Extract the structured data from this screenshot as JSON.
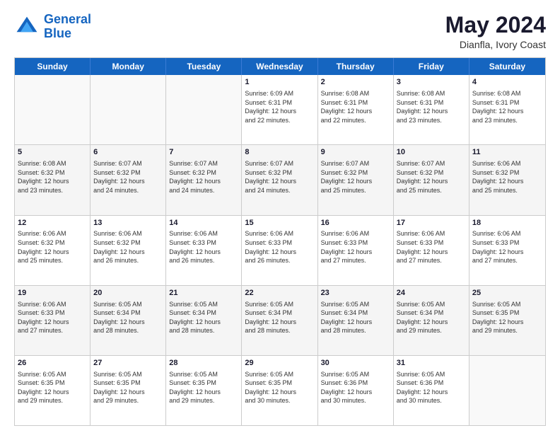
{
  "header": {
    "logo_line1": "General",
    "logo_line2": "Blue",
    "month": "May 2024",
    "location": "Dianfla, Ivory Coast"
  },
  "weekdays": [
    "Sunday",
    "Monday",
    "Tuesday",
    "Wednesday",
    "Thursday",
    "Friday",
    "Saturday"
  ],
  "rows": [
    [
      {
        "day": "",
        "info": ""
      },
      {
        "day": "",
        "info": ""
      },
      {
        "day": "",
        "info": ""
      },
      {
        "day": "1",
        "info": "Sunrise: 6:09 AM\nSunset: 6:31 PM\nDaylight: 12 hours\nand 22 minutes."
      },
      {
        "day": "2",
        "info": "Sunrise: 6:08 AM\nSunset: 6:31 PM\nDaylight: 12 hours\nand 22 minutes."
      },
      {
        "day": "3",
        "info": "Sunrise: 6:08 AM\nSunset: 6:31 PM\nDaylight: 12 hours\nand 23 minutes."
      },
      {
        "day": "4",
        "info": "Sunrise: 6:08 AM\nSunset: 6:31 PM\nDaylight: 12 hours\nand 23 minutes."
      }
    ],
    [
      {
        "day": "5",
        "info": "Sunrise: 6:08 AM\nSunset: 6:32 PM\nDaylight: 12 hours\nand 23 minutes."
      },
      {
        "day": "6",
        "info": "Sunrise: 6:07 AM\nSunset: 6:32 PM\nDaylight: 12 hours\nand 24 minutes."
      },
      {
        "day": "7",
        "info": "Sunrise: 6:07 AM\nSunset: 6:32 PM\nDaylight: 12 hours\nand 24 minutes."
      },
      {
        "day": "8",
        "info": "Sunrise: 6:07 AM\nSunset: 6:32 PM\nDaylight: 12 hours\nand 24 minutes."
      },
      {
        "day": "9",
        "info": "Sunrise: 6:07 AM\nSunset: 6:32 PM\nDaylight: 12 hours\nand 25 minutes."
      },
      {
        "day": "10",
        "info": "Sunrise: 6:07 AM\nSunset: 6:32 PM\nDaylight: 12 hours\nand 25 minutes."
      },
      {
        "day": "11",
        "info": "Sunrise: 6:06 AM\nSunset: 6:32 PM\nDaylight: 12 hours\nand 25 minutes."
      }
    ],
    [
      {
        "day": "12",
        "info": "Sunrise: 6:06 AM\nSunset: 6:32 PM\nDaylight: 12 hours\nand 25 minutes."
      },
      {
        "day": "13",
        "info": "Sunrise: 6:06 AM\nSunset: 6:32 PM\nDaylight: 12 hours\nand 26 minutes."
      },
      {
        "day": "14",
        "info": "Sunrise: 6:06 AM\nSunset: 6:33 PM\nDaylight: 12 hours\nand 26 minutes."
      },
      {
        "day": "15",
        "info": "Sunrise: 6:06 AM\nSunset: 6:33 PM\nDaylight: 12 hours\nand 26 minutes."
      },
      {
        "day": "16",
        "info": "Sunrise: 6:06 AM\nSunset: 6:33 PM\nDaylight: 12 hours\nand 27 minutes."
      },
      {
        "day": "17",
        "info": "Sunrise: 6:06 AM\nSunset: 6:33 PM\nDaylight: 12 hours\nand 27 minutes."
      },
      {
        "day": "18",
        "info": "Sunrise: 6:06 AM\nSunset: 6:33 PM\nDaylight: 12 hours\nand 27 minutes."
      }
    ],
    [
      {
        "day": "19",
        "info": "Sunrise: 6:06 AM\nSunset: 6:33 PM\nDaylight: 12 hours\nand 27 minutes."
      },
      {
        "day": "20",
        "info": "Sunrise: 6:05 AM\nSunset: 6:34 PM\nDaylight: 12 hours\nand 28 minutes."
      },
      {
        "day": "21",
        "info": "Sunrise: 6:05 AM\nSunset: 6:34 PM\nDaylight: 12 hours\nand 28 minutes."
      },
      {
        "day": "22",
        "info": "Sunrise: 6:05 AM\nSunset: 6:34 PM\nDaylight: 12 hours\nand 28 minutes."
      },
      {
        "day": "23",
        "info": "Sunrise: 6:05 AM\nSunset: 6:34 PM\nDaylight: 12 hours\nand 28 minutes."
      },
      {
        "day": "24",
        "info": "Sunrise: 6:05 AM\nSunset: 6:34 PM\nDaylight: 12 hours\nand 29 minutes."
      },
      {
        "day": "25",
        "info": "Sunrise: 6:05 AM\nSunset: 6:35 PM\nDaylight: 12 hours\nand 29 minutes."
      }
    ],
    [
      {
        "day": "26",
        "info": "Sunrise: 6:05 AM\nSunset: 6:35 PM\nDaylight: 12 hours\nand 29 minutes."
      },
      {
        "day": "27",
        "info": "Sunrise: 6:05 AM\nSunset: 6:35 PM\nDaylight: 12 hours\nand 29 minutes."
      },
      {
        "day": "28",
        "info": "Sunrise: 6:05 AM\nSunset: 6:35 PM\nDaylight: 12 hours\nand 29 minutes."
      },
      {
        "day": "29",
        "info": "Sunrise: 6:05 AM\nSunset: 6:35 PM\nDaylight: 12 hours\nand 30 minutes."
      },
      {
        "day": "30",
        "info": "Sunrise: 6:05 AM\nSunset: 6:36 PM\nDaylight: 12 hours\nand 30 minutes."
      },
      {
        "day": "31",
        "info": "Sunrise: 6:05 AM\nSunset: 6:36 PM\nDaylight: 12 hours\nand 30 minutes."
      },
      {
        "day": "",
        "info": ""
      }
    ]
  ]
}
